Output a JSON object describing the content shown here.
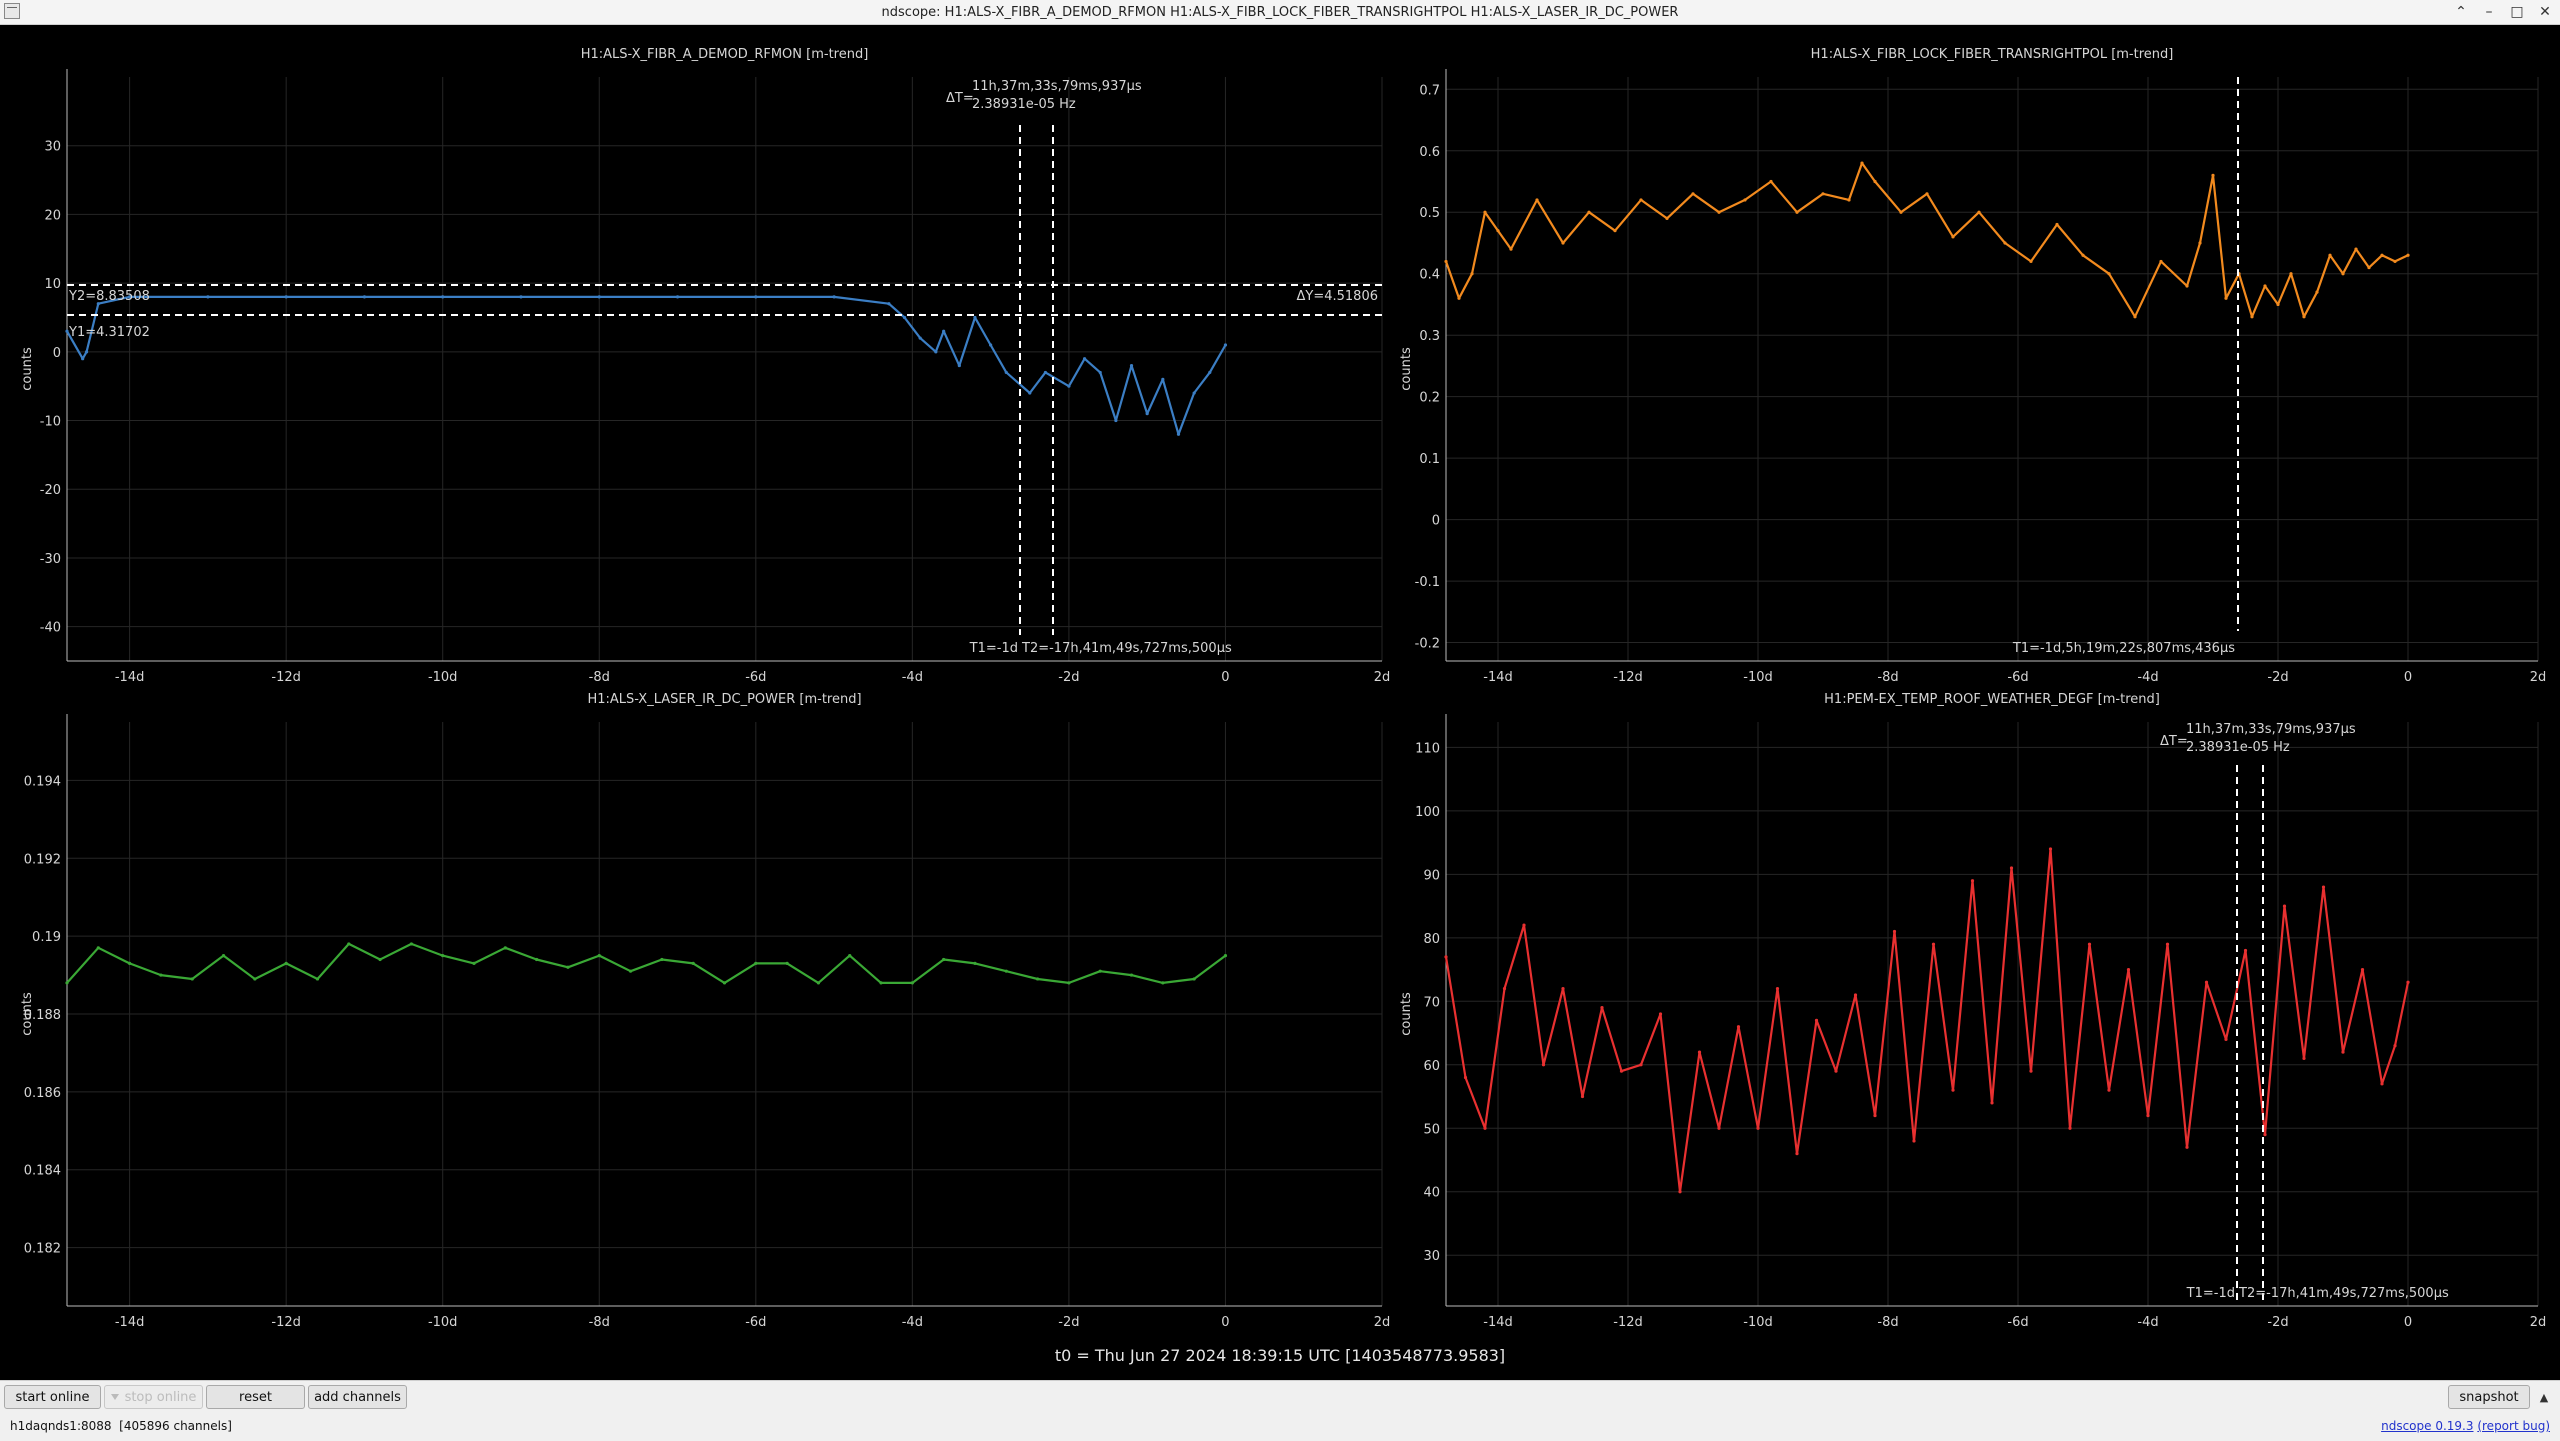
{
  "window": {
    "title": "ndscope: H1:ALS-X_FIBR_A_DEMOD_RFMON H1:ALS-X_FIBR_LOCK_FIBER_TRANSRIGHTPOL H1:ALS-X_LASER_IR_DC_POWER"
  },
  "t0_label": "t0 = Thu Jun 27 2024 18:39:15 UTC [1403548773.9583]",
  "toolbar": {
    "start_online": "start online",
    "stop_online": "stop online",
    "reset": "reset",
    "add_channels": "add channels",
    "snapshot": "snapshot"
  },
  "status": {
    "server": "h1daqnds1:8088",
    "channels": "[405896 channels]",
    "version": "ndscope 0.19.3",
    "report": "(report bug)"
  },
  "colors": {
    "blue": "#3b7ec4",
    "orange": "#f28a1e",
    "green": "#3aa835",
    "red": "#e83030",
    "cursor": "#ffffff",
    "grid": "#262626"
  },
  "icons": [
    "app-icon",
    "minimize-icon",
    "maximize-icon",
    "close-icon",
    "chevron-up-icon"
  ],
  "chart_data": [
    {
      "type": "line",
      "title": "H1:ALS-X_FIBR_A_DEMOD_RFMON [m-trend]",
      "ylabel": "counts",
      "xlim": [
        -14.8,
        2.0
      ],
      "ylim": [
        -45,
        40
      ],
      "xticks": [
        -14,
        -12,
        -10,
        -8,
        -6,
        -4,
        -2,
        0,
        2
      ],
      "xtick_labels": [
        "-14d",
        "-12d",
        "-10d",
        "-8d",
        "-6d",
        "-4d",
        "-2d",
        "0",
        "2d"
      ],
      "yticks": [
        30,
        20,
        10,
        0,
        -10,
        -20,
        -30,
        -40
      ],
      "ytick_labels": [
        "30",
        "20",
        "10",
        "0",
        "-10",
        "-20",
        "-30",
        "-40"
      ],
      "grid": true,
      "series": [
        {
          "color": "blue",
          "x": [
            -14.8,
            -14.6,
            -14.55,
            -14.4,
            -14,
            -13,
            -12,
            -11,
            -10,
            -9,
            -8,
            -7,
            -6,
            -5,
            -4.3,
            -4.1,
            -3.9,
            -3.7,
            -3.6,
            -3.4,
            -3.2,
            -3.0,
            -2.8,
            -2.5,
            -2.3,
            -2.0,
            -1.8,
            -1.6,
            -1.4,
            -1.2,
            -1.0,
            -0.8,
            -0.6,
            -0.4,
            -0.2,
            0.0
          ],
          "y": [
            3,
            -1,
            0,
            7,
            8,
            8,
            8,
            8,
            8,
            8,
            8,
            8,
            8,
            8,
            7,
            5,
            2,
            0,
            3,
            -2,
            5,
            1,
            -3,
            -6,
            -3,
            -5,
            -1,
            -3,
            -10,
            -2,
            -9,
            -4,
            -12,
            -6,
            -3,
            1
          ]
        }
      ],
      "cursors": {
        "t1": "T1=-1d",
        "t2": "T2=-17h,41m,49s,727ms,500μs",
        "dt": "ΔT=",
        "dt_val": "11h,37m,33s,79ms,937μs",
        "dt_hz": "2.38931e-05 Hz",
        "y1": "Y1=4.31702",
        "y2": "Y2=8.83508",
        "dy": "ΔY=4.51806"
      }
    },
    {
      "type": "line",
      "title": "H1:ALS-X_FIBR_LOCK_FIBER_TRANSRIGHTPOL [m-trend]",
      "ylabel": "counts",
      "xlim": [
        -14.8,
        2.0
      ],
      "ylim": [
        -0.23,
        0.72
      ],
      "xticks": [
        -14,
        -12,
        -10,
        -8,
        -6,
        -4,
        -2,
        0,
        2
      ],
      "xtick_labels": [
        "-14d",
        "-12d",
        "-10d",
        "-8d",
        "-6d",
        "-4d",
        "-2d",
        "0",
        "2d"
      ],
      "yticks": [
        0.7,
        0.6,
        0.5,
        0.4,
        0.3,
        0.2,
        0.1,
        0,
        -0.1,
        -0.2
      ],
      "ytick_labels": [
        "0.7",
        "0.6",
        "0.5",
        "0.4",
        "0.3",
        "0.2",
        "0.1",
        "0",
        "-0.1",
        "-0.2"
      ],
      "grid": true,
      "series": [
        {
          "color": "orange",
          "x": [
            -14.8,
            -14.6,
            -14.4,
            -14.2,
            -14,
            -13.8,
            -13.4,
            -13,
            -12.6,
            -12.2,
            -11.8,
            -11.4,
            -11,
            -10.6,
            -10.2,
            -9.8,
            -9.4,
            -9,
            -8.6,
            -8.4,
            -8.2,
            -7.8,
            -7.4,
            -7,
            -6.6,
            -6.2,
            -5.8,
            -5.4,
            -5,
            -4.6,
            -4.2,
            -3.8,
            -3.4,
            -3.2,
            -3.0,
            -2.8,
            -2.6,
            -2.4,
            -2.2,
            -2.0,
            -1.8,
            -1.6,
            -1.4,
            -1.2,
            -1.0,
            -0.8,
            -0.6,
            -0.4,
            -0.2,
            0.0
          ],
          "y": [
            0.42,
            0.36,
            0.4,
            0.5,
            0.47,
            0.44,
            0.52,
            0.45,
            0.5,
            0.47,
            0.52,
            0.49,
            0.53,
            0.5,
            0.52,
            0.55,
            0.5,
            0.53,
            0.52,
            0.58,
            0.55,
            0.5,
            0.53,
            0.46,
            0.5,
            0.45,
            0.42,
            0.48,
            0.43,
            0.4,
            0.33,
            0.42,
            0.38,
            0.45,
            0.56,
            0.36,
            0.4,
            0.33,
            0.38,
            0.35,
            0.4,
            0.33,
            0.37,
            0.43,
            0.4,
            0.44,
            0.41,
            0.43,
            0.42,
            0.43
          ]
        }
      ],
      "cursors": {
        "t1": "T1=-1d,5h,19m,22s,807ms,436μs"
      }
    },
    {
      "type": "line",
      "title": "H1:ALS-X_LASER_IR_DC_POWER [m-trend]",
      "ylabel": "counts",
      "xlim": [
        -14.8,
        2.0
      ],
      "ylim": [
        0.1805,
        0.1955
      ],
      "xticks": [
        -14,
        -12,
        -10,
        -8,
        -6,
        -4,
        -2,
        0,
        2
      ],
      "xtick_labels": [
        "-14d",
        "-12d",
        "-10d",
        "-8d",
        "-6d",
        "-4d",
        "-2d",
        "0",
        "2d"
      ],
      "yticks": [
        0.194,
        0.192,
        0.19,
        0.188,
        0.186,
        0.184,
        0.182
      ],
      "ytick_labels": [
        "0.194",
        "0.192",
        "0.19",
        "0.188",
        "0.186",
        "0.184",
        "0.182"
      ],
      "grid": true,
      "series": [
        {
          "color": "green",
          "x": [
            -14.8,
            -14.4,
            -14,
            -13.6,
            -13.2,
            -12.8,
            -12.4,
            -12,
            -11.6,
            -11.2,
            -10.8,
            -10.4,
            -10,
            -9.6,
            -9.2,
            -8.8,
            -8.4,
            -8,
            -7.6,
            -7.2,
            -6.8,
            -6.4,
            -6,
            -5.6,
            -5.2,
            -4.8,
            -4.4,
            -4,
            -3.6,
            -3.2,
            -2.8,
            -2.4,
            -2,
            -1.6,
            -1.2,
            -0.8,
            -0.4,
            0.0
          ],
          "y": [
            0.1888,
            0.1897,
            0.1893,
            0.189,
            0.1889,
            0.1895,
            0.1889,
            0.1893,
            0.1889,
            0.1898,
            0.1894,
            0.1898,
            0.1895,
            0.1893,
            0.1897,
            0.1894,
            0.1892,
            0.1895,
            0.1891,
            0.1894,
            0.1893,
            0.1888,
            0.1893,
            0.1893,
            0.1888,
            0.1895,
            0.1888,
            0.1888,
            0.1894,
            0.1893,
            0.1891,
            0.1889,
            0.1888,
            0.1891,
            0.189,
            0.1888,
            0.1889,
            0.1895
          ]
        }
      ],
      "cursors": {}
    },
    {
      "type": "line",
      "title": "H1:PEM-EX_TEMP_ROOF_WEATHER_DEGF [m-trend]",
      "ylabel": "counts",
      "xlim": [
        -14.8,
        2.0
      ],
      "ylim": [
        22,
        114
      ],
      "xticks": [
        -14,
        -12,
        -10,
        -8,
        -6,
        -4,
        -2,
        0,
        2
      ],
      "xtick_labels": [
        "-14d",
        "-12d",
        "-10d",
        "-8d",
        "-6d",
        "-4d",
        "-2d",
        "0",
        "2d"
      ],
      "yticks": [
        110,
        100,
        90,
        80,
        70,
        60,
        50,
        40,
        30
      ],
      "ytick_labels": [
        "110",
        "100",
        "90",
        "80",
        "70",
        "60",
        "50",
        "40",
        "30"
      ],
      "grid": true,
      "series": [
        {
          "color": "red",
          "x": [
            -14.8,
            -14.5,
            -14.2,
            -13.9,
            -13.6,
            -13.3,
            -13.0,
            -12.7,
            -12.4,
            -12.1,
            -11.8,
            -11.5,
            -11.2,
            -10.9,
            -10.6,
            -10.3,
            -10.0,
            -9.7,
            -9.4,
            -9.1,
            -8.8,
            -8.5,
            -8.2,
            -7.9,
            -7.6,
            -7.3,
            -7.0,
            -6.7,
            -6.4,
            -6.1,
            -5.8,
            -5.5,
            -5.2,
            -4.9,
            -4.6,
            -4.3,
            -4.0,
            -3.7,
            -3.4,
            -3.1,
            -2.8,
            -2.5,
            -2.2,
            -1.9,
            -1.6,
            -1.3,
            -1.0,
            -0.7,
            -0.4,
            -0.2,
            0.0
          ],
          "y": [
            77,
            58,
            50,
            72,
            82,
            60,
            72,
            55,
            69,
            59,
            60,
            68,
            40,
            62,
            50,
            66,
            50,
            72,
            46,
            67,
            59,
            71,
            52,
            81,
            48,
            79,
            56,
            89,
            54,
            91,
            59,
            94,
            50,
            79,
            56,
            75,
            52,
            79,
            47,
            73,
            64,
            78,
            49,
            85,
            61,
            88,
            62,
            75,
            57,
            63,
            73
          ]
        }
      ],
      "cursors": {
        "t1": "T1=-1d",
        "t2": "T2=-17h,41m,49s,727ms,500μs",
        "dt": "ΔT=",
        "dt_val": "11h,37m,33s,79ms,937μs",
        "dt_hz": "2.38931e-05 Hz"
      }
    }
  ]
}
